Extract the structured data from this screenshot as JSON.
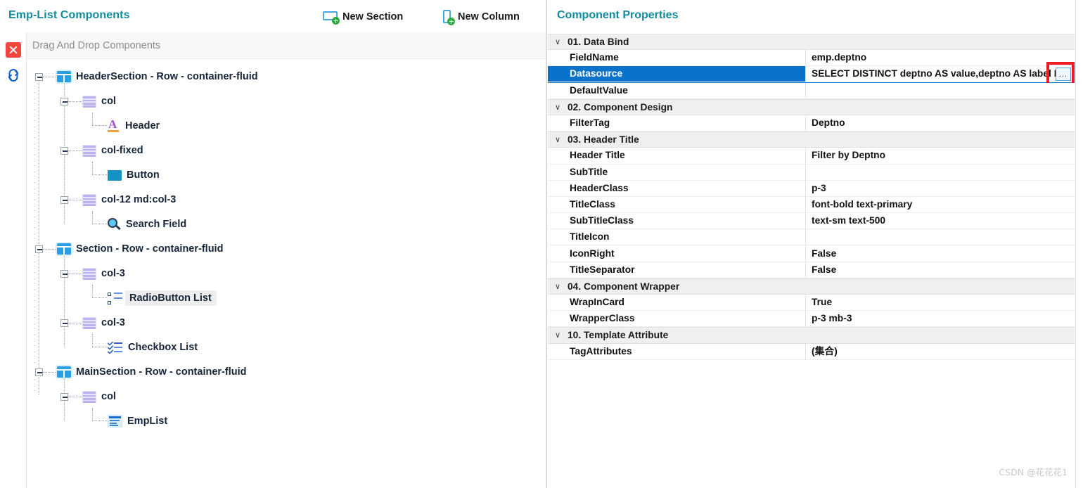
{
  "left": {
    "app_title": "Emp-List Components",
    "toolbar": [
      {
        "label": "New Section",
        "icon": "new-section-icon"
      },
      {
        "label": "New Column",
        "icon": "new-column-icon"
      }
    ],
    "rail": [
      {
        "icon": "close-icon",
        "color": "#f1453d"
      },
      {
        "icon": "refresh-icon",
        "color": "#1a5fd0"
      }
    ],
    "dnd_hint": "Drag And Drop Components",
    "tree": [
      {
        "label": "HeaderSection - Row - container-fluid",
        "icon": "row-icon",
        "depth": 0,
        "expander": true,
        "selected": false
      },
      {
        "label": "col",
        "icon": "column-icon",
        "depth": 1,
        "expander": true,
        "selected": false
      },
      {
        "label": "Header",
        "icon": "header-icon",
        "depth": 2,
        "expander": false,
        "selected": false
      },
      {
        "label": "col-fixed",
        "icon": "column-icon",
        "depth": 1,
        "expander": true,
        "selected": false
      },
      {
        "label": "Button",
        "icon": "button-icon",
        "depth": 2,
        "expander": false,
        "selected": false
      },
      {
        "label": "col-12 md:col-3",
        "icon": "column-icon",
        "depth": 1,
        "expander": true,
        "selected": false
      },
      {
        "label": "Search Field",
        "icon": "search-icon",
        "depth": 2,
        "expander": false,
        "selected": false
      },
      {
        "label": "Section - Row - container-fluid",
        "icon": "row-icon",
        "depth": 0,
        "expander": true,
        "selected": false
      },
      {
        "label": "col-3",
        "icon": "column-icon",
        "depth": 1,
        "expander": true,
        "selected": false
      },
      {
        "label": "RadioButton List",
        "icon": "radiolist-icon",
        "depth": 2,
        "expander": false,
        "selected": true
      },
      {
        "label": "col-3",
        "icon": "column-icon",
        "depth": 1,
        "expander": true,
        "selected": false
      },
      {
        "label": "Checkbox List",
        "icon": "checklist-icon",
        "depth": 2,
        "expander": false,
        "selected": false
      },
      {
        "label": "MainSection - Row - container-fluid",
        "icon": "row-icon",
        "depth": 0,
        "expander": true,
        "selected": false
      },
      {
        "label": "col",
        "icon": "column-icon",
        "depth": 1,
        "expander": true,
        "selected": false
      },
      {
        "label": "EmpList",
        "icon": "emplist-icon",
        "depth": 2,
        "expander": false,
        "selected": false
      }
    ]
  },
  "right": {
    "title": "Component Properties",
    "rows": [
      {
        "kind": "category",
        "name": "01. Data Bind"
      },
      {
        "kind": "property",
        "name": "FieldName",
        "value": "emp.deptno"
      },
      {
        "kind": "property",
        "name": "Datasource",
        "value": "SELECT  DISTINCT deptno AS value,deptno AS label F",
        "selected": true,
        "caret": true,
        "ellipsis": "..."
      },
      {
        "kind": "property",
        "name": "DefaultValue",
        "value": ""
      },
      {
        "kind": "category",
        "name": "02. Component Design"
      },
      {
        "kind": "property",
        "name": "FilterTag",
        "value": "Deptno"
      },
      {
        "kind": "category",
        "name": "03. Header Title"
      },
      {
        "kind": "property",
        "name": "Header Title",
        "value": "Filter by Deptno"
      },
      {
        "kind": "property",
        "name": "SubTitle",
        "value": ""
      },
      {
        "kind": "property",
        "name": "HeaderClass",
        "value": "p-3"
      },
      {
        "kind": "property",
        "name": "TitleClass",
        "value": "font-bold text-primary"
      },
      {
        "kind": "property",
        "name": "SubTitleClass",
        "value": "text-sm text-500"
      },
      {
        "kind": "property",
        "name": "TitleIcon",
        "value": ""
      },
      {
        "kind": "property",
        "name": "IconRight",
        "value": "False"
      },
      {
        "kind": "property",
        "name": "TitleSeparator",
        "value": "False"
      },
      {
        "kind": "category",
        "name": "04. Component Wrapper"
      },
      {
        "kind": "property",
        "name": "WrapInCard",
        "value": "True"
      },
      {
        "kind": "property",
        "name": "WrapperClass",
        "value": "p-3 mb-3"
      },
      {
        "kind": "category",
        "name": "10. Template Attribute"
      },
      {
        "kind": "property",
        "name": "TagAttributes",
        "value": "(集合)"
      }
    ]
  },
  "watermark": "CSDN @花花花1",
  "colors": {
    "accent_teal": "#128a9c",
    "selection_blue": "#0a72c8",
    "highlight_red": "#ec1c24",
    "row_icon_blue": "#2a9fe0"
  }
}
